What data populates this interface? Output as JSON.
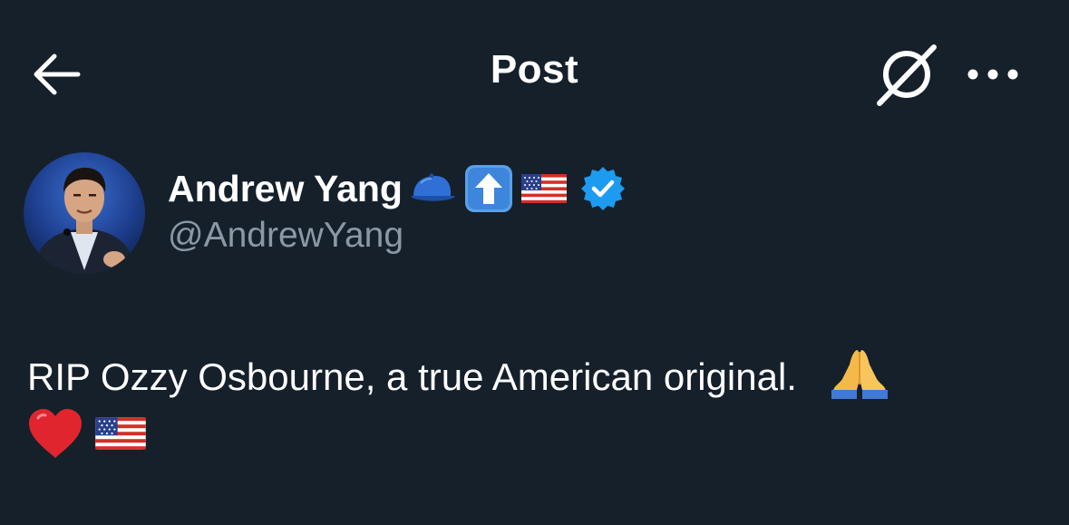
{
  "header": {
    "title": "Post",
    "back_icon": "arrow-left-icon",
    "grok_icon": "grok-icon",
    "more_icon": "more-horizontal-icon"
  },
  "author": {
    "display_name": "Andrew Yang",
    "handle": "@AndrewYang",
    "name_emojis": [
      "cap-icon",
      "up-arrow-icon",
      "us-flag-icon"
    ],
    "verified": true,
    "verified_color": "#1d9bf0"
  },
  "post": {
    "text": "RIP Ozzy Osbourne, a true American original.",
    "emojis_line1": [
      "folded-hands-icon"
    ],
    "emojis_line2": [
      "red-heart-icon",
      "us-flag-icon"
    ]
  },
  "colors": {
    "background": "#15202b",
    "text": "#ffffff",
    "secondary_text": "#8b98a5"
  }
}
